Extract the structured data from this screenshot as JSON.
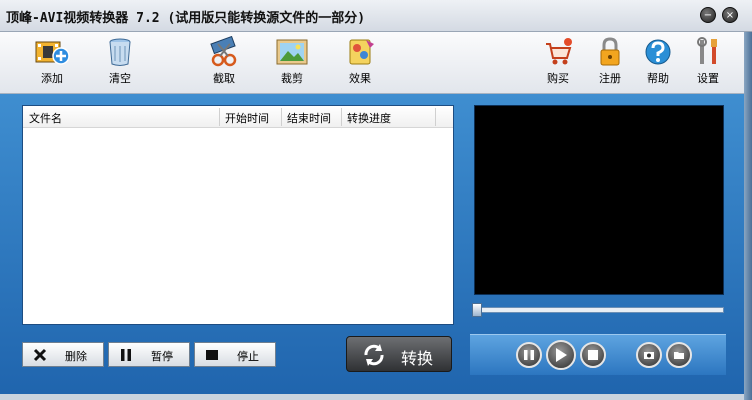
{
  "window": {
    "title": "顶峰-AVI视频转换器 7.2 (试用版只能转换源文件的一部分)",
    "min_glyph": "−",
    "close_glyph": "×"
  },
  "toolbar": {
    "add": "添加",
    "clear": "清空",
    "capture": "截取",
    "crop": "裁剪",
    "effects": "效果",
    "buy": "购买",
    "register": "注册",
    "help": "帮助",
    "settings": "设置"
  },
  "file_list": {
    "columns": [
      "文件名",
      "开始时间",
      "结束时间",
      "转换进度"
    ],
    "rows": []
  },
  "actions": {
    "delete": "删除",
    "pause": "暂停",
    "stop": "停止",
    "convert": "转换"
  },
  "player": {
    "seek_position": 0
  },
  "colors": {
    "accent_blue": "#2f7ac4",
    "video_bg": "#000000"
  },
  "icons": [
    "film-add-icon",
    "clear-bin-icon",
    "scissors-icon",
    "picture-crop-icon",
    "effects-icon",
    "cart-icon",
    "lock-icon",
    "help-icon",
    "tools-icon",
    "delete-x-icon",
    "pause-icon",
    "stop-icon",
    "convert-arrows-icon",
    "snapshot-icon",
    "open-folder-icon"
  ]
}
